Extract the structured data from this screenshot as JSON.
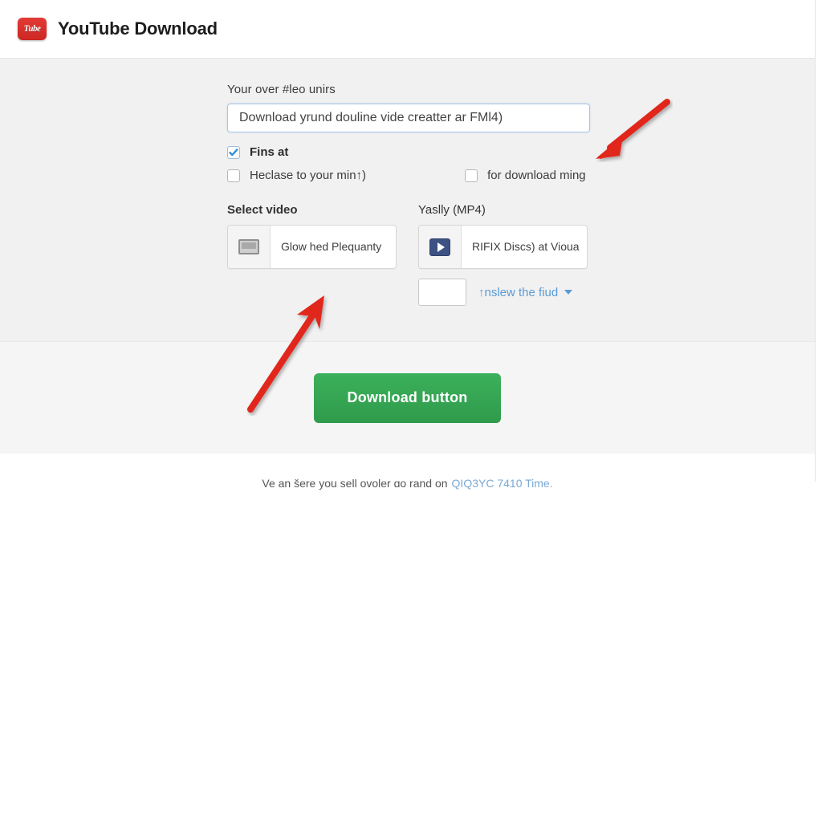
{
  "header": {
    "logo_text": "Tube",
    "logo_name": "youtube-logo-icon",
    "title": "YouTube Download"
  },
  "form": {
    "url_label": "Your over #leo unirs",
    "url_value": "Download yrund douline vide creatter ar FMl4)",
    "url_placeholder": "Download yrund douline vide creatter ar FMl4)",
    "checkbox_primary": {
      "label": "Fins at",
      "checked": true
    },
    "checkbox_secondary_left": {
      "label": "Heclase to your min↑)",
      "checked": false
    },
    "checkbox_secondary_right": {
      "label": "for download ming",
      "checked": false
    },
    "left_column": {
      "title": "Select video",
      "card_text": "Glow hed Plequanty",
      "icon": "monitor-icon"
    },
    "right_column": {
      "title": "Yaslly (MP4)",
      "card_text": "RIFIX Discs) at Vioua",
      "icon": "play-icon",
      "dropdown_value": "",
      "dropdown_link": "↑nslew the fiud",
      "dropdown_caret": "chevron-down-icon"
    }
  },
  "action": {
    "download_label": "Download button"
  },
  "footer": {
    "text": "Ve an šere you sell ovoler ɑo rand on",
    "link": "QIQ3YC 7410 Time."
  },
  "annotations": {
    "arrow_1": "red-arrow-pointing-to-input",
    "arrow_2": "red-arrow-pointing-to-select-video"
  },
  "colors": {
    "brand_red": "#cc2723",
    "accent_green": "#34a853",
    "link_blue": "#5b9bd5",
    "panel_gray": "#f1f1f1",
    "arrow_red": "#e1251b"
  }
}
